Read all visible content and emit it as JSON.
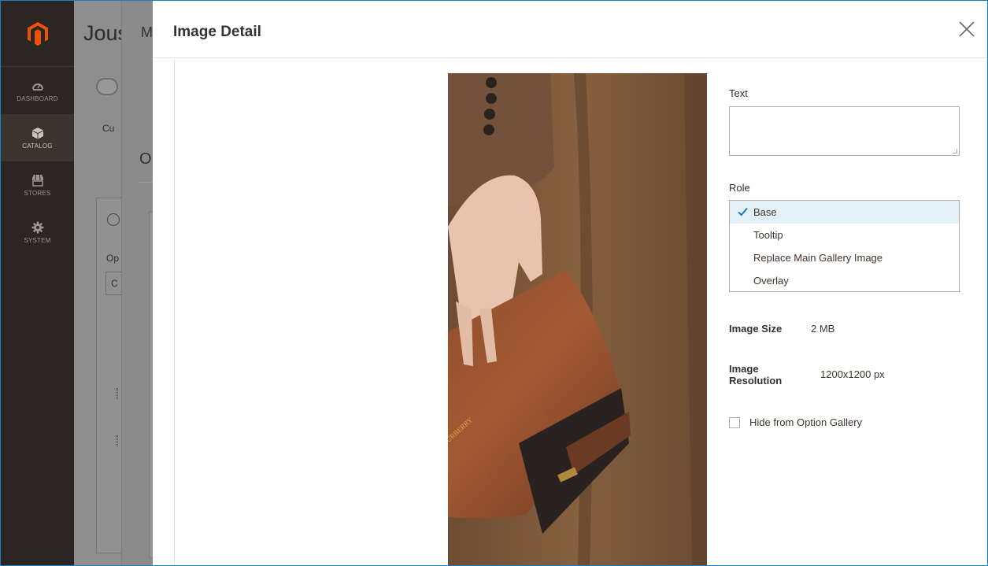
{
  "admin_nav": {
    "items": [
      {
        "label": "DASHBOARD",
        "icon": "dashboard-icon"
      },
      {
        "label": "CATALOG",
        "icon": "catalog-box-icon"
      },
      {
        "label": "STORES",
        "icon": "stores-icon"
      },
      {
        "label": "SYSTEM",
        "icon": "gear-icon"
      }
    ]
  },
  "background_page": {
    "title": "Jous",
    "sub_text": "Cu",
    "option_text": "Op",
    "select_text": "C",
    "modal_title_partial": "M",
    "section_title_partial": "O"
  },
  "modal": {
    "title": "Image Detail",
    "close_icon": "close-icon",
    "text_label": "Text",
    "text_value": "",
    "role_label": "Role",
    "roles": [
      {
        "label": "Base",
        "selected": true
      },
      {
        "label": "Tooltip",
        "selected": false
      },
      {
        "label": "Replace Main Gallery Image",
        "selected": false
      },
      {
        "label": "Overlay",
        "selected": false
      }
    ],
    "image_size_label": "Image Size",
    "image_size_value": "2 MB",
    "image_resolution_label": "Image Resolution",
    "image_resolution_value": "1200x1200 px",
    "hide_label": "Hide from Option Gallery",
    "hide_checked": false
  },
  "colors": {
    "admin_nav_bg": "#2b2623",
    "selected_role_bg": "#e5f1f9",
    "check_color": "#1979c3",
    "frame_border": "#1a7ec2"
  }
}
